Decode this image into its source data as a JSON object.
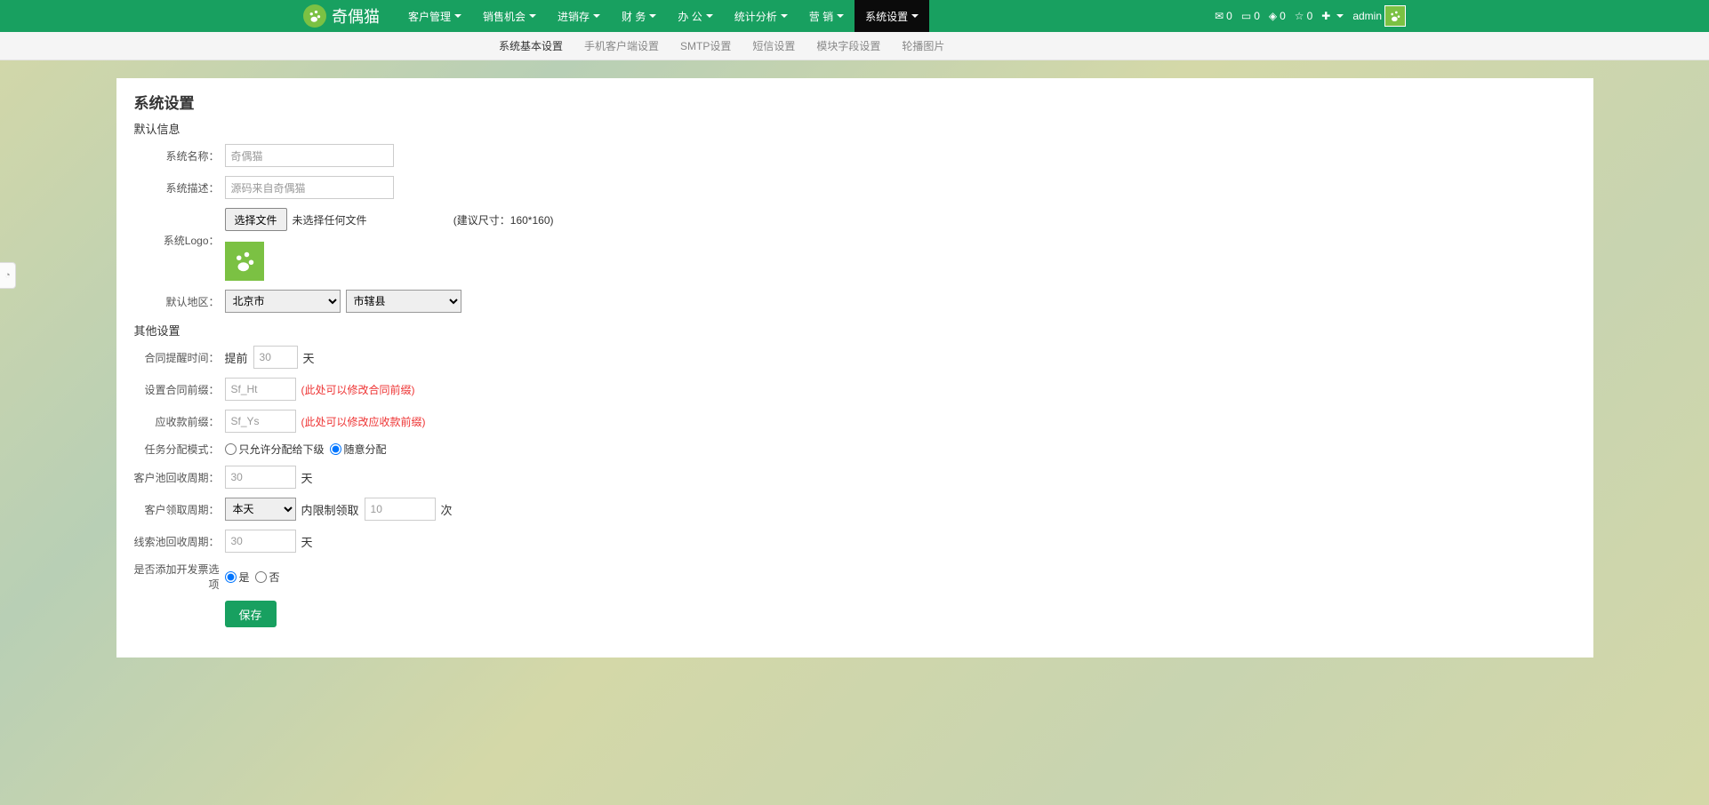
{
  "brand": {
    "text": "奇偶猫"
  },
  "nav": {
    "items": [
      {
        "label": "客户管理"
      },
      {
        "label": "销售机会"
      },
      {
        "label": "进销存"
      },
      {
        "label": "财 务"
      },
      {
        "label": "办 公"
      },
      {
        "label": "统计分析"
      },
      {
        "label": "营 销"
      },
      {
        "label": "系统设置",
        "active": true
      }
    ]
  },
  "topright": {
    "mail_count": "0",
    "card_count": "0",
    "diamond_count": "0",
    "star_count": "0",
    "username": "admin"
  },
  "subtabs": [
    {
      "label": "系统基本设置",
      "active": true
    },
    {
      "label": "手机客户端设置"
    },
    {
      "label": "SMTP设置"
    },
    {
      "label": "短信设置"
    },
    {
      "label": "模块字段设置"
    },
    {
      "label": "轮播图片"
    }
  ],
  "page": {
    "title": "系统设置"
  },
  "legend1": "默认信息",
  "legend2": "其他设置",
  "labels": {
    "sysname": "系统名称：",
    "sysdesc": "系统描述：",
    "syslogo": "系统Logo：",
    "region": "默认地区：",
    "contract_remind": "合同提醒时间：",
    "contract_prefix": "设置合同前缀：",
    "receivable_prefix": "应收款前缀：",
    "task_mode": "任务分配模式：",
    "cust_recycle": "客户池回收周期：",
    "cust_claim": "客户领取周期：",
    "lead_recycle": "线索池回收周期：",
    "invoice": "是否添加开发票选项"
  },
  "values": {
    "sysname": "奇偶猫",
    "sysdesc": "源码来自奇偶猫",
    "file_btn": "选择文件",
    "file_status": "未选择任何文件",
    "logo_hint": "(建议尺寸：160*160)",
    "province": "北京市",
    "city": "市辖县",
    "prefix_before": "提前",
    "remind_days": "30",
    "day_unit": "天",
    "contract_prefix": "Sf_Ht",
    "contract_prefix_note": "(此处可以修改合同前缀)",
    "receivable_prefix": "Sf_Ys",
    "receivable_prefix_note": "(此处可以修改应收款前缀)",
    "task_mode_a": "只允许分配给下级",
    "task_mode_b": "随意分配",
    "cust_recycle": "30",
    "claim_period_sel": "本天",
    "claim_mid": "内限制领取",
    "claim_times": "10",
    "times_unit": "次",
    "lead_recycle": "30",
    "invoice_yes": "是",
    "invoice_no": "否",
    "save": "保存"
  }
}
